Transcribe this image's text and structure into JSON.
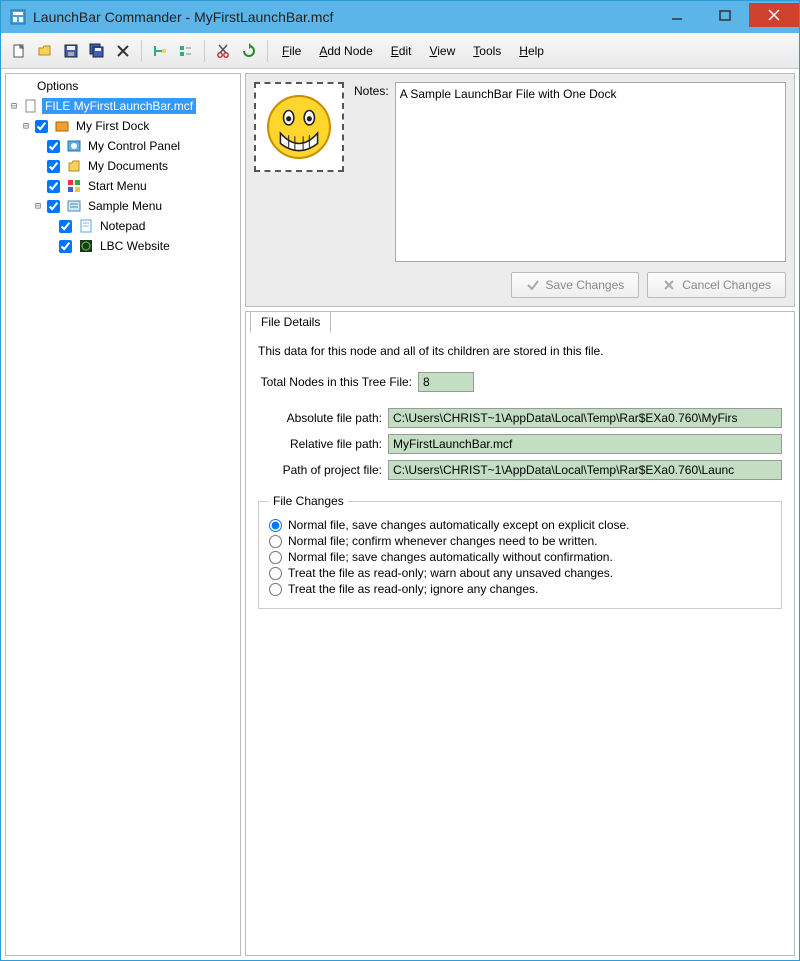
{
  "window": {
    "title": "LaunchBar Commander - MyFirstLaunchBar.mcf"
  },
  "menu": {
    "file": "File",
    "add_node": "Add Node",
    "edit": "Edit",
    "view": "View",
    "tools": "Tools",
    "help": "Help"
  },
  "tree": {
    "header": "Options",
    "file_node": "FILE MyFirstLaunchBar.mcf",
    "items": [
      {
        "label": "My First Dock"
      },
      {
        "label": "My Control Panel"
      },
      {
        "label": "My Documents"
      },
      {
        "label": "Start Menu"
      },
      {
        "label": "Sample Menu"
      },
      {
        "label": "Notepad"
      },
      {
        "label": "LBC Website"
      }
    ]
  },
  "notes": {
    "label": "Notes:",
    "value": "A Sample LaunchBar File with One Dock"
  },
  "buttons": {
    "save": "Save Changes",
    "cancel": "Cancel Changes"
  },
  "details": {
    "tab": "File Details",
    "description": "This data for this node and all of its children are stored in this file.",
    "total_label": "Total Nodes in this Tree File:",
    "total_value": "8",
    "abs_label": "Absolute file path:",
    "abs_value": "C:\\Users\\CHRIST~1\\AppData\\Local\\Temp\\Rar$EXa0.760\\MyFirs",
    "rel_label": "Relative file path:",
    "rel_value": "MyFirstLaunchBar.mcf",
    "proj_label": "Path of project file:",
    "proj_value": "C:\\Users\\CHRIST~1\\AppData\\Local\\Temp\\Rar$EXa0.760\\Launc",
    "changes_legend": "File Changes",
    "radios": [
      "Normal file, save changes automatically except on explicit close.",
      "Normal file; confirm whenever changes need to be written.",
      "Normal file; save changes automatically without confirmation.",
      "Treat the file as read-only; warn about any unsaved changes.",
      "Treat the file as read-only; ignore any changes."
    ]
  }
}
